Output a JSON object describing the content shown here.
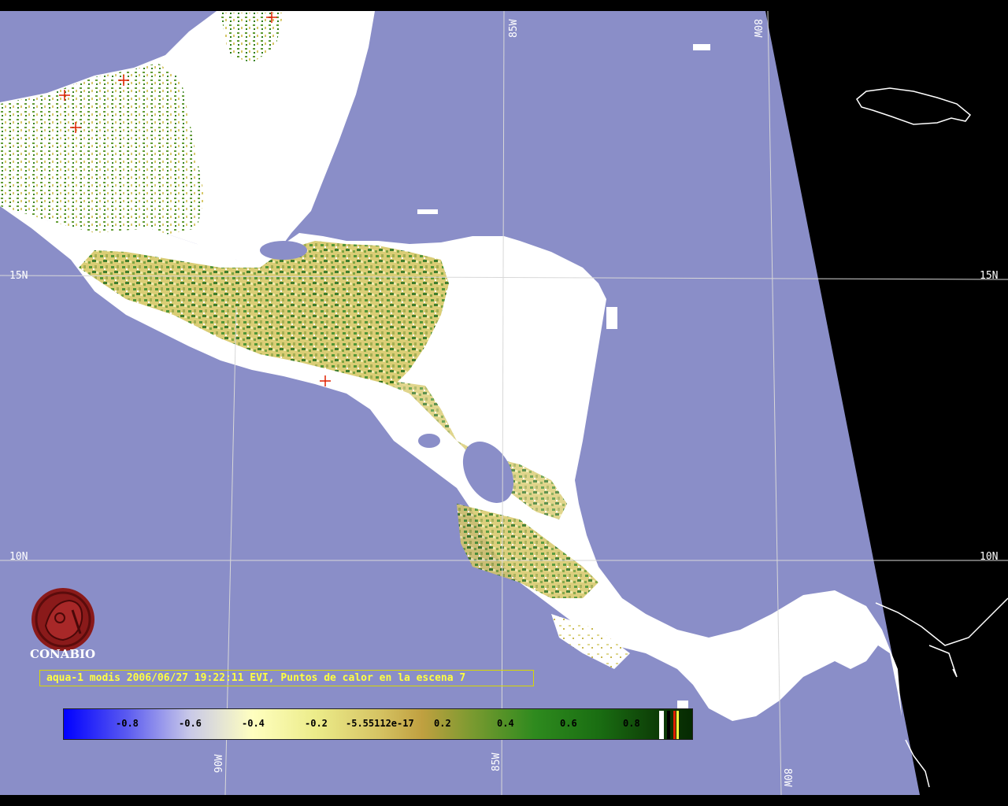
{
  "caption": "aqua-1 modis 2006/06/27 19:22:11 EVI, Puntos de calor en la escena 7",
  "org": "CONABIO",
  "grid_labels": {
    "lat_15_left": "15N",
    "lat_15_right": "15N",
    "lat_10_left": "10N",
    "lat_10_right": "10N",
    "lon_85_top": "85W",
    "lon_80_top": "80W",
    "lon_90_bottom": "90W",
    "lon_85_bottom": "85W",
    "lon_80_bottom": "80W"
  },
  "colorbar": {
    "ticks": [
      "-0.8",
      "-0.6",
      "-0.4",
      "-0.2",
      "-5.55112e-17",
      "0.2",
      "0.4",
      "0.6",
      "0.8"
    ]
  },
  "colors": {
    "ocean": "#8a8ec8",
    "cloud": "#ffffff",
    "vegetation_low": "#d8c860",
    "vegetation_high": "#2e7a1e",
    "hotspot": "#e02000",
    "outside": "#000000",
    "caption_text": "#ffff40"
  },
  "hotspots_count_visible": 5
}
